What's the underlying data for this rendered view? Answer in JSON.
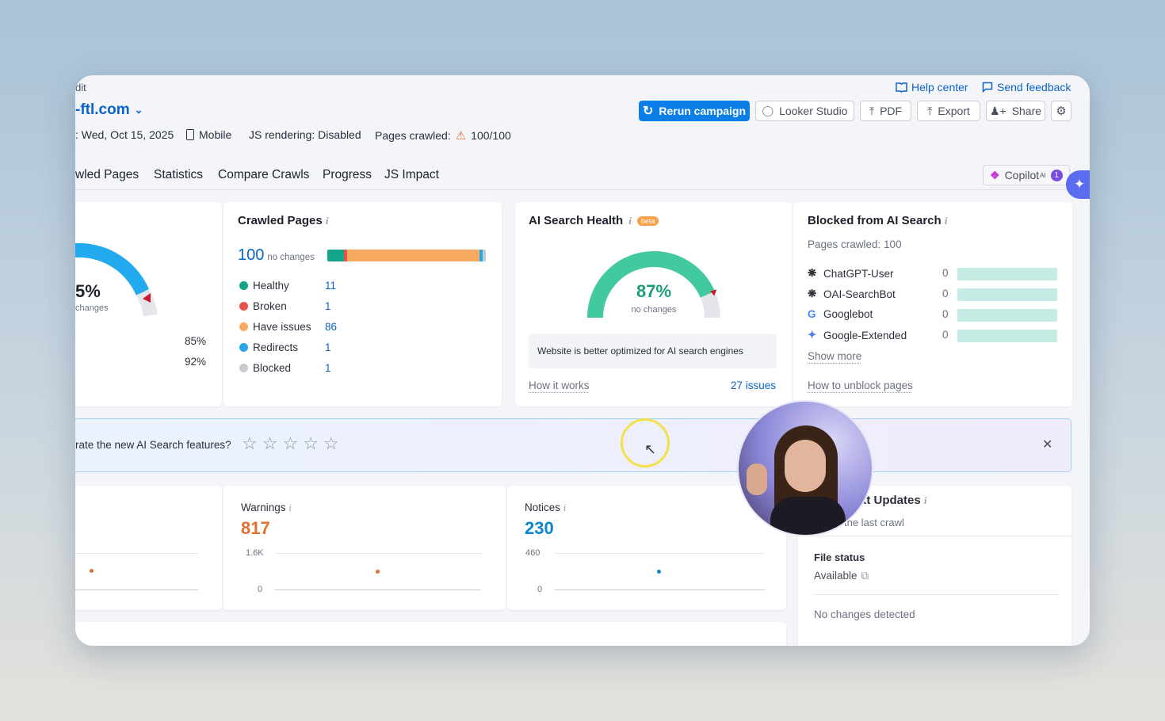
{
  "header": {
    "crumb": "dit",
    "domain": "-ftl.com",
    "help_center": "Help center",
    "send_feedback": "Send feedback",
    "buttons": {
      "rerun": "Rerun campaign",
      "looker": "Looker Studio",
      "pdf": "PDF",
      "export": "Export",
      "share": "Share"
    },
    "meta": {
      "date": ": Wed, Oct 15, 2025",
      "device": "Mobile",
      "js": "JS rendering: Disabled",
      "pages_label": "Pages crawled:",
      "pages_value": "100/100"
    }
  },
  "tabs": [
    "wled Pages",
    "Statistics",
    "Compare Crawls",
    "Progress",
    "JS Impact"
  ],
  "copilot": {
    "label": "Copilot",
    "sup": "AI",
    "badge": "1"
  },
  "site_health": {
    "value": "5%",
    "sub": "changes",
    "rows": [
      "85%",
      "92%"
    ]
  },
  "crawled_pages": {
    "title": "Crawled Pages",
    "total": "100",
    "total_note": "no changes",
    "items": [
      {
        "label": "Healthy",
        "count": "11",
        "color": "#12a58a"
      },
      {
        "label": "Broken",
        "count": "1",
        "color": "#e9514a"
      },
      {
        "label": "Have issues",
        "count": "86",
        "color": "#f6ab60"
      },
      {
        "label": "Redirects",
        "count": "1",
        "color": "#2aa6ea"
      },
      {
        "label": "Blocked",
        "count": "1",
        "color": "#c7cad1"
      }
    ]
  },
  "ai_health": {
    "title": "AI Search Health",
    "badge": "beta",
    "value": "87%",
    "value_fraction": 0.87,
    "note": "no changes",
    "message": "Website is better optimized for AI search engines",
    "how": "How it works",
    "issues": "27 issues"
  },
  "blocked_ai": {
    "title": "Blocked from AI Search",
    "pages": "Pages crawled: 100",
    "bots": [
      {
        "name": "ChatGPT-User",
        "value": "0",
        "icon": "openai-icon"
      },
      {
        "name": "OAI-SearchBot",
        "value": "0",
        "icon": "openai-icon"
      },
      {
        "name": "Googlebot",
        "value": "0",
        "icon": "google-icon"
      },
      {
        "name": "Google-Extended",
        "value": "0",
        "icon": "gemini-icon"
      }
    ],
    "show_more": "Show more",
    "unblock": "How to unblock pages"
  },
  "feedback": {
    "question": "rate the new AI Search features?",
    "stars": 5
  },
  "warnings": {
    "title": "Warnings",
    "value": "817",
    "ytop": "1.6K",
    "ybot": "0",
    "color": "#e2702f"
  },
  "notices": {
    "title": "Notices",
    "value": "230",
    "ytop": "460",
    "ybot": "0",
    "color": "#0a87d0"
  },
  "llms": {
    "title": "xt Updates",
    "sub": "the last crawl",
    "file_status_label": "File status",
    "file_status": "Available",
    "changes": "No changes detected"
  },
  "colors": {
    "accent": "#0b7ee8",
    "link": "#0a63c8",
    "teal": "#12a58a",
    "orange": "#f6ab60"
  }
}
